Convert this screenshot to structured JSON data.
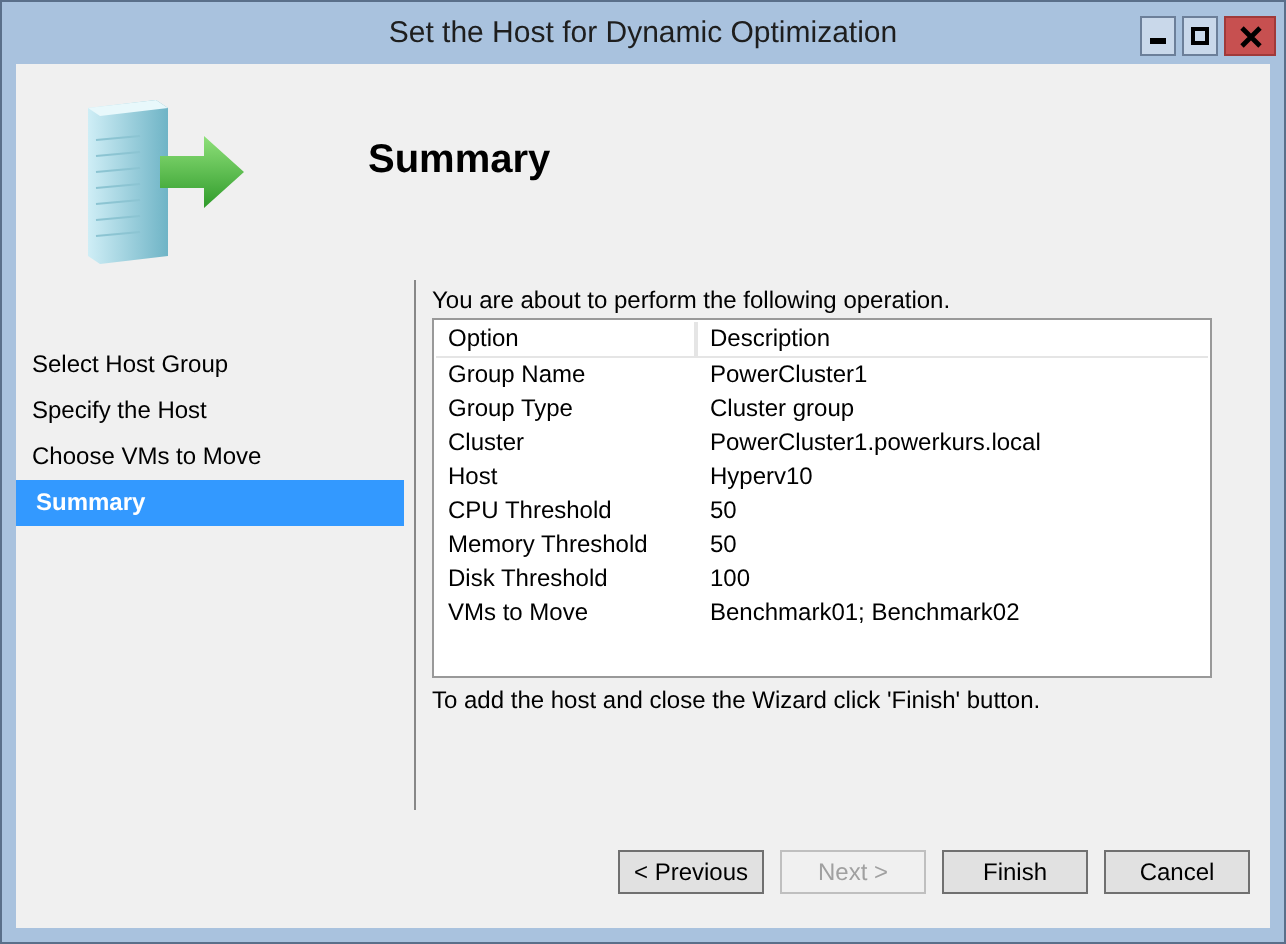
{
  "window": {
    "title": "Set the Host for Dynamic Optimization"
  },
  "header": {
    "title": "Summary"
  },
  "steps": [
    {
      "label": "Select Host Group",
      "selected": false
    },
    {
      "label": "Specify the Host",
      "selected": false
    },
    {
      "label": "Choose VMs to Move",
      "selected": false
    },
    {
      "label": "Summary",
      "selected": true
    }
  ],
  "intro": "You are about to perform the following operation.",
  "table": {
    "columns": [
      "Option",
      "Description"
    ],
    "rows": [
      [
        "Group Name",
        "PowerCluster1"
      ],
      [
        "Group Type",
        "Cluster group"
      ],
      [
        "Cluster",
        "PowerCluster1.powerkurs.local"
      ],
      [
        "Host",
        "Hyperv10"
      ],
      [
        "CPU Threshold",
        "50"
      ],
      [
        "Memory Threshold",
        "50"
      ],
      [
        "Disk Threshold",
        "100"
      ],
      [
        "VMs to Move",
        "Benchmark01; Benchmark02"
      ]
    ]
  },
  "footer_note": "To add the host and close the Wizard click 'Finish' button.",
  "buttons": [
    {
      "label": "< Previous",
      "disabled": false
    },
    {
      "label": "Next >",
      "disabled": true
    },
    {
      "label": "Finish",
      "disabled": false
    },
    {
      "label": "Cancel",
      "disabled": false
    }
  ]
}
